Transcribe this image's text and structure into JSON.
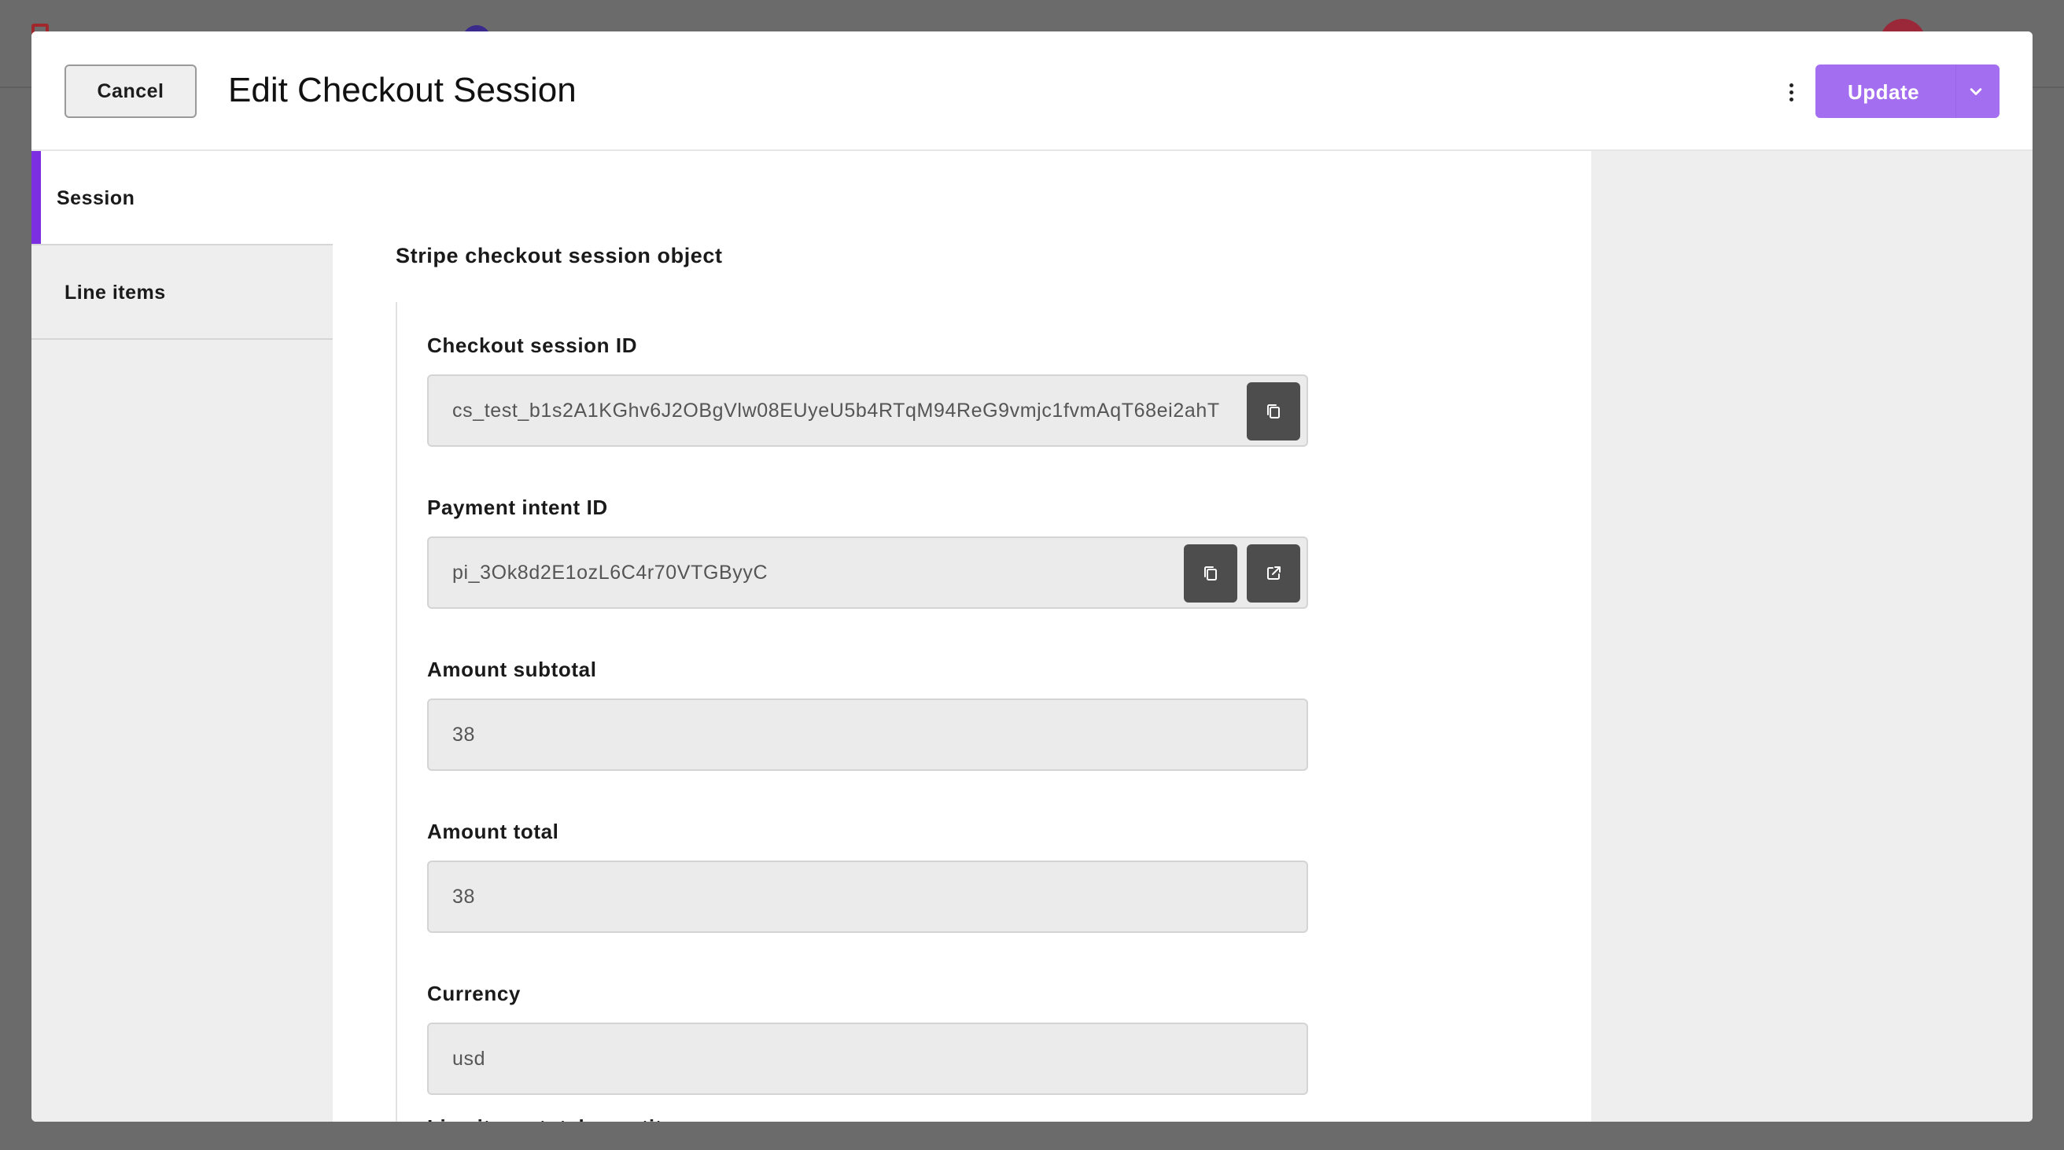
{
  "header": {
    "cancel_label": "Cancel",
    "title": "Edit Checkout Session",
    "update_label": "Update"
  },
  "sidebar": {
    "tabs": [
      {
        "label": "Session",
        "active": true
      },
      {
        "label": "Line items",
        "active": false
      }
    ]
  },
  "main": {
    "section_title": "Stripe checkout session object",
    "fields": [
      {
        "label": "Checkout session ID",
        "value": "cs_test_b1s2A1KGhv6J2OBgVlw08EUyeU5b4RTqM94ReG9vmjc1fvmAqT68ei2ahT"
      },
      {
        "label": "Payment intent ID",
        "value": "pi_3Ok8d2E1ozL6C4r70VTGByyC"
      },
      {
        "label": "Amount subtotal",
        "value": "38"
      },
      {
        "label": "Amount total",
        "value": "38"
      },
      {
        "label": "Currency",
        "value": "usd"
      }
    ],
    "partial_label": "Line items total quantity"
  },
  "colors": {
    "accent": "#7b2fe0",
    "update_button": "#a46ef0",
    "icon_button": "#4d4d4d"
  },
  "icons": [
    "copy-icon",
    "external-link-icon",
    "more-vertical-icon",
    "chevron-down-icon"
  ]
}
